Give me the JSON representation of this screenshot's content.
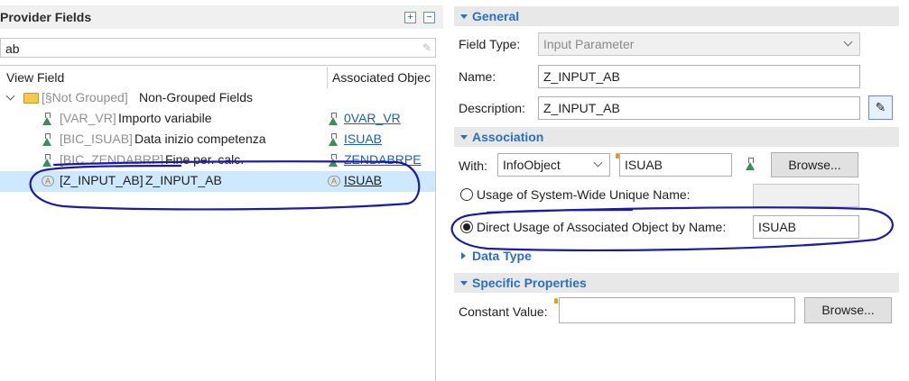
{
  "left_panel": {
    "title": "Provider Fields",
    "expand_icon": "expand-all-icon",
    "collapse_icon": "collapse-all-icon",
    "search": {
      "value": "ab",
      "clear_icon": "clear-search-icon"
    },
    "columns": {
      "view_field": "View Field",
      "associated_object": "Associated Objec"
    },
    "group": {
      "tech": "[§Not Grouped]",
      "label": "Non-Grouped Fields",
      "icon": "folder-icon"
    },
    "rows": [
      {
        "tech": "[VAR_VR]",
        "label": "Importo variabile",
        "assoc": "0VAR_VR",
        "icon": "variable-icon"
      },
      {
        "tech": "[BIC_ISUAB]",
        "label": "Data inizio competenza",
        "assoc": "ISUAB",
        "icon": "infoobject-icon"
      },
      {
        "tech": "[BIC_ZENDABRP]",
        "label": "Fine per. calc.",
        "assoc": "ZENDABRPE",
        "icon": "infoobject-icon"
      },
      {
        "tech": "[Z_INPUT_AB]",
        "label": "Z_INPUT_AB",
        "assoc": "ISUAB",
        "icon": "input-parameter-icon",
        "selected": true
      }
    ]
  },
  "general": {
    "title": "General",
    "field_type_label": "Field Type:",
    "field_type_value": "Input Parameter",
    "name_label": "Name:",
    "name_value": "Z_INPUT_AB",
    "description_label": "Description:",
    "description_value": "Z_INPUT_AB",
    "edit_icon": "pencil-icon"
  },
  "association": {
    "title": "Association",
    "with_label": "With:",
    "with_type": "InfoObject",
    "with_value": "ISUAB",
    "browse_label": "Browse...",
    "system_wide_label": "Usage of System-Wide Unique Name:",
    "system_wide_value": "",
    "direct_usage_label": "Direct Usage of Associated Object by Name:",
    "direct_usage_value": "ISUAB",
    "selected_option": "direct_usage"
  },
  "data_type": {
    "title": "Data Type"
  },
  "specific_properties": {
    "title": "Specific Properties",
    "constant_value_label": "Constant Value:",
    "constant_value": "",
    "browse_label": "Browse..."
  },
  "colors": {
    "accent": "#2c6fbf",
    "selection": "#cde8ff",
    "annotation_ink": "#1a1aa8"
  }
}
